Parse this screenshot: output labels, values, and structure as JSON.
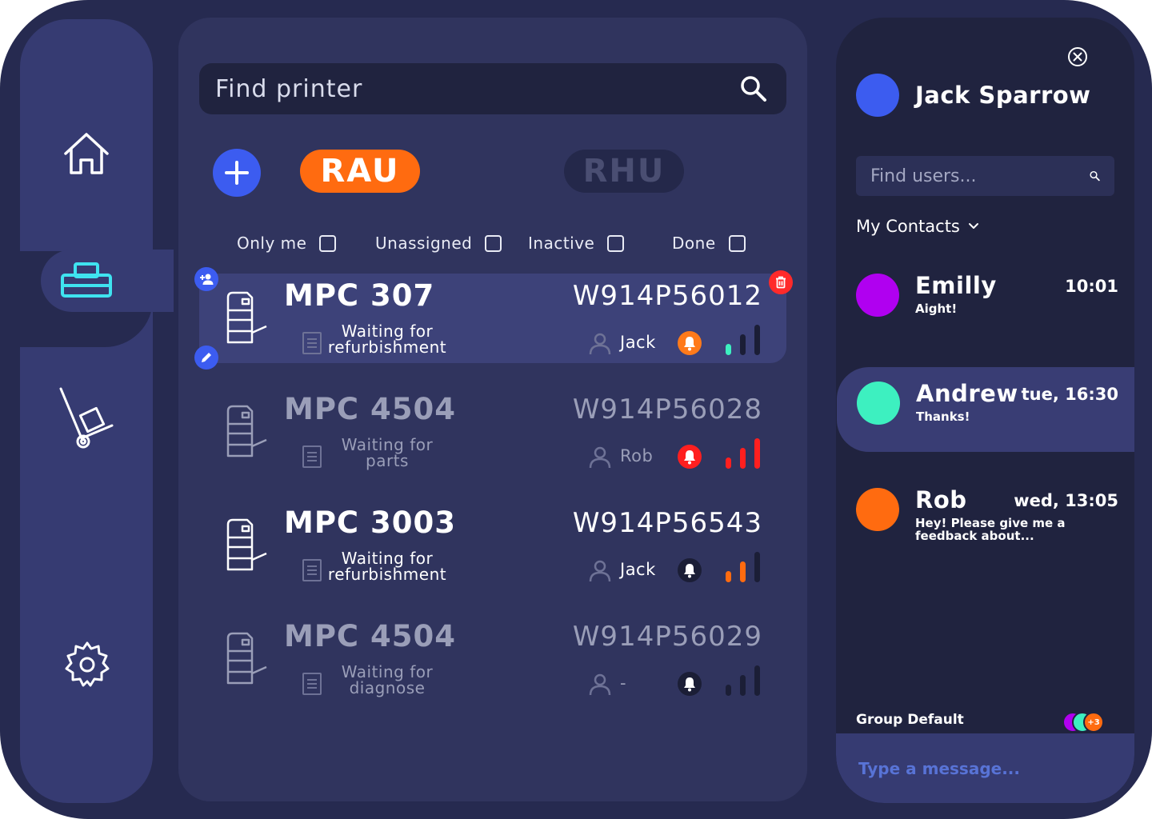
{
  "nav": {
    "items": [
      {
        "icon": "home-icon",
        "active": false
      },
      {
        "icon": "printer-icon",
        "active": true
      },
      {
        "icon": "hand-truck-icon",
        "active": false
      },
      {
        "icon": "gear-icon",
        "active": false
      }
    ]
  },
  "search": {
    "placeholder": "Find printer"
  },
  "tabs": [
    {
      "label": "RAU",
      "active": true
    },
    {
      "label": "RHU",
      "active": false
    }
  ],
  "filters": [
    {
      "label": "Only me",
      "checked": false
    },
    {
      "label": "Unassigned",
      "checked": false
    },
    {
      "label": "Inactive",
      "checked": false
    },
    {
      "label": "Done",
      "checked": false
    }
  ],
  "printers": [
    {
      "model": "MPC 307",
      "status_line1": "Waiting for",
      "status_line2": "refurbishment",
      "serial": "W914P56012",
      "user": "Jack",
      "bell_color": "#ff7a1a",
      "signal_level": 1,
      "signal_color": "#3df0c0",
      "selected": true,
      "dim": false
    },
    {
      "model": "MPC 4504",
      "status_line1": "Waiting for",
      "status_line2": "parts",
      "serial": "W914P56028",
      "user": "Rob",
      "bell_color": "#ff1f1f",
      "signal_level": 3,
      "signal_color": "#ff1f1f",
      "selected": false,
      "dim": true
    },
    {
      "model": "MPC 3003",
      "status_line1": "Waiting for",
      "status_line2": "refurbishment",
      "serial": "W914P56543",
      "user": "Jack",
      "bell_color": "#1b1e36",
      "signal_level": 2,
      "signal_color": "#ff6b10",
      "selected": false,
      "dim": false
    },
    {
      "model": "MPC 4504",
      "status_line1": "Waiting for",
      "status_line2": "diagnose",
      "serial": "W914P56029",
      "user": "-",
      "bell_color": "#1b1e36",
      "signal_level": 0,
      "signal_color": "#1b1e36",
      "selected": false,
      "dim": true
    }
  ],
  "chat": {
    "me": {
      "name": "Jack Sparrow",
      "avatar_color": "#3c5cf0"
    },
    "search_placeholder": "Find users...",
    "contacts_label": "My Contacts",
    "contacts": [
      {
        "name": "Emilly",
        "message": "Aight!",
        "time": "10:01",
        "avatar_color": "#b000f0",
        "active": false
      },
      {
        "name": "Andrew",
        "message": "Thanks!",
        "time": "tue, 16:30",
        "avatar_color": "#3df0c0",
        "active": true
      },
      {
        "name": "Rob",
        "message": "Hey! Please give me a feedback about...",
        "time": "wed, 13:05",
        "avatar_color": "#ff6b10",
        "active": false
      }
    ],
    "group": {
      "label": "Group Default",
      "extra_count": "+3",
      "avatar_colors": [
        "#b000f0",
        "#3df0c0",
        "#ff6b10"
      ]
    },
    "message_placeholder": "Type a message..."
  }
}
